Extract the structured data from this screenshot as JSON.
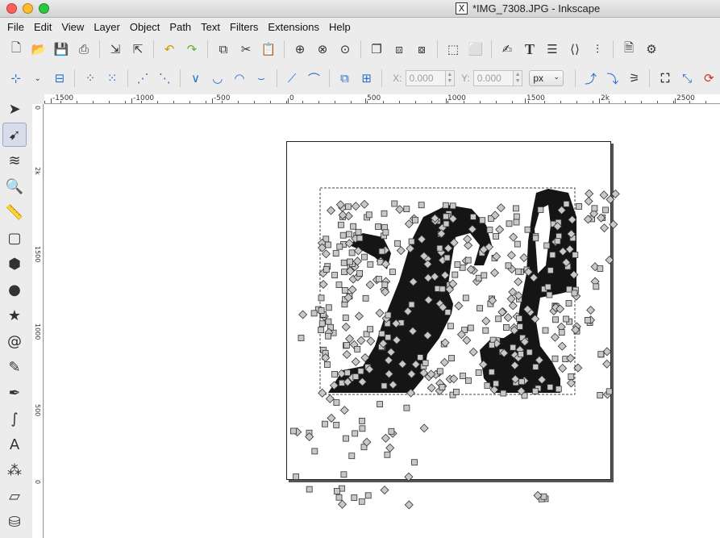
{
  "window": {
    "title": "*IMG_7308.JPG - Inkscape",
    "app_icon": "x11-icon"
  },
  "menubar": {
    "items": [
      "File",
      "Edit",
      "View",
      "Layer",
      "Object",
      "Path",
      "Text",
      "Filters",
      "Extensions",
      "Help"
    ]
  },
  "commands_bar": {
    "icons": [
      "new-document-icon",
      "open-icon",
      "save-icon",
      "print-icon",
      "import-icon",
      "export-icon",
      "undo-icon",
      "redo-icon",
      "copy-icon",
      "cut-icon",
      "paste-icon",
      "zoom-selection-icon",
      "zoom-drawing-icon",
      "zoom-page-icon",
      "duplicate-icon",
      "clone-icon",
      "unlink-clone-icon",
      "group-icon",
      "ungroup-icon",
      "fill-stroke-icon",
      "text-font-icon",
      "layers-icon",
      "xml-editor-icon",
      "align-icon",
      "document-properties-icon",
      "preferences-icon"
    ]
  },
  "node_toolbar": {
    "x_label": "X:",
    "x_value": "0.000",
    "y_label": "Y:",
    "y_value": "0.000",
    "unit": "px"
  },
  "rulers": {
    "horizontal_labels": [
      "-1500",
      "-1000",
      "-500",
      "0",
      "500",
      "1000",
      "1500",
      "2k",
      "2500"
    ],
    "vertical_labels": [
      "0",
      "2k",
      "1500",
      "1000",
      "500",
      "0"
    ]
  },
  "tools": [
    {
      "name": "selector-tool",
      "glyph": "➤"
    },
    {
      "name": "node-tool",
      "glyph": "➹",
      "active": true
    },
    {
      "name": "tweak-tool",
      "glyph": "≋"
    },
    {
      "name": "zoom-tool",
      "glyph": "🔍"
    },
    {
      "name": "measure-tool",
      "glyph": "📏"
    },
    {
      "name": "rectangle-tool",
      "glyph": "▢"
    },
    {
      "name": "3d-box-tool",
      "glyph": "⬢"
    },
    {
      "name": "ellipse-tool",
      "glyph": "●"
    },
    {
      "name": "star-tool",
      "glyph": "★"
    },
    {
      "name": "spiral-tool",
      "glyph": "@"
    },
    {
      "name": "pencil-tool",
      "glyph": "✎"
    },
    {
      "name": "pen-tool",
      "glyph": "✒"
    },
    {
      "name": "calligraphy-tool",
      "glyph": "∫"
    },
    {
      "name": "text-tool",
      "glyph": "A"
    },
    {
      "name": "spray-tool",
      "glyph": "⁂"
    },
    {
      "name": "eraser-tool",
      "glyph": "▱"
    },
    {
      "name": "paint-bucket-tool",
      "glyph": "⛁"
    }
  ]
}
